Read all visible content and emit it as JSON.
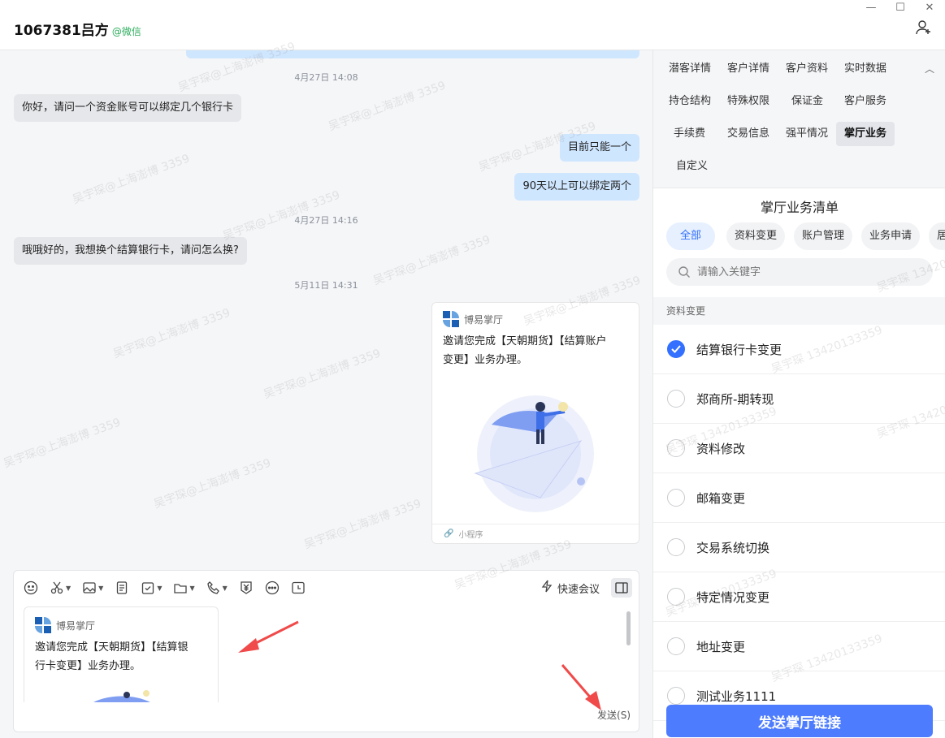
{
  "window": {
    "title": "1067381吕方",
    "source_tag": "@微信",
    "controls": [
      "minimize",
      "maximize",
      "close"
    ]
  },
  "chat": {
    "messages": [
      {
        "type": "timestamp",
        "text": "4月27日 14:08"
      },
      {
        "type": "left",
        "text": "你好，请问一个资金账号可以绑定几个银行卡"
      },
      {
        "type": "right",
        "text": "目前只能一个"
      },
      {
        "type": "right",
        "text": "90天以上可以绑定两个"
      },
      {
        "type": "timestamp",
        "text": "4月27日 14:16"
      },
      {
        "type": "left",
        "text": "哦哦好的，我想换个结算银行卡，请问怎么换?"
      },
      {
        "type": "timestamp",
        "text": "5月11日 14:31"
      }
    ],
    "card": {
      "brand": "博易掌厅",
      "desc_line1": "邀请您完成【天朝期货】【结算账户",
      "desc_line2": "变更】业务办理。",
      "footer": "小程序"
    }
  },
  "composer": {
    "tools": [
      "emoji-icon",
      "scissors-icon",
      "image-icon",
      "doc-icon",
      "task-icon",
      "folder-icon",
      "phone-icon",
      "yuan-icon",
      "more-icon",
      "clock-icon"
    ],
    "quick_meeting": "快速会议",
    "draft_card": {
      "brand": "博易掌厅",
      "desc_line1": "邀请您完成【天朝期货】【结算银",
      "desc_line2": "行卡变更】业务办理。"
    },
    "send_label": "发送(S)"
  },
  "right_panel": {
    "tabs": [
      {
        "label": "潜客详情",
        "active": false
      },
      {
        "label": "客户详情",
        "active": false
      },
      {
        "label": "客户资料",
        "active": false
      },
      {
        "label": "实时数据",
        "active": false
      },
      {
        "label": "持仓结构",
        "active": false
      },
      {
        "label": "特殊权限",
        "active": false
      },
      {
        "label": "保证金",
        "active": false
      },
      {
        "label": "客户服务",
        "active": false
      },
      {
        "label": "手续费",
        "active": false
      },
      {
        "label": "交易信息",
        "active": false
      },
      {
        "label": "强平情况",
        "active": false
      },
      {
        "label": "掌厅业务",
        "active": true
      },
      {
        "label": "自定义",
        "active": false
      }
    ],
    "list_title": "掌厅业务清单",
    "filters": [
      {
        "label": "全部",
        "active": true
      },
      {
        "label": "资料变更",
        "active": false
      },
      {
        "label": "账户管理",
        "active": false
      },
      {
        "label": "业务申请",
        "active": false
      },
      {
        "label": "居",
        "active": false
      }
    ],
    "search_placeholder": "请输入关键字",
    "section_label": "资料变更",
    "items": [
      {
        "label": "结算银行卡变更",
        "checked": true
      },
      {
        "label": "郑商所-期转现",
        "checked": false
      },
      {
        "label": "资料修改",
        "checked": false
      },
      {
        "label": "邮箱变更",
        "checked": false
      },
      {
        "label": "交易系统切换",
        "checked": false
      },
      {
        "label": "特定情况变更",
        "checked": false
      },
      {
        "label": "地址变更",
        "checked": false
      },
      {
        "label": "测试业务1111",
        "checked": false
      }
    ],
    "send_button": "发送掌厅链接"
  },
  "watermark": {
    "chat_text": "吴宇琛@上海澎博 3359",
    "panel_text": "吴宇琛 13420133359"
  },
  "colors": {
    "accent": "#3370ff",
    "send_button": "#4d7cfe",
    "right_bubble": "#cfe6ff",
    "left_bubble": "#e6e7ea",
    "annotation_arrow": "#f04a4a"
  }
}
